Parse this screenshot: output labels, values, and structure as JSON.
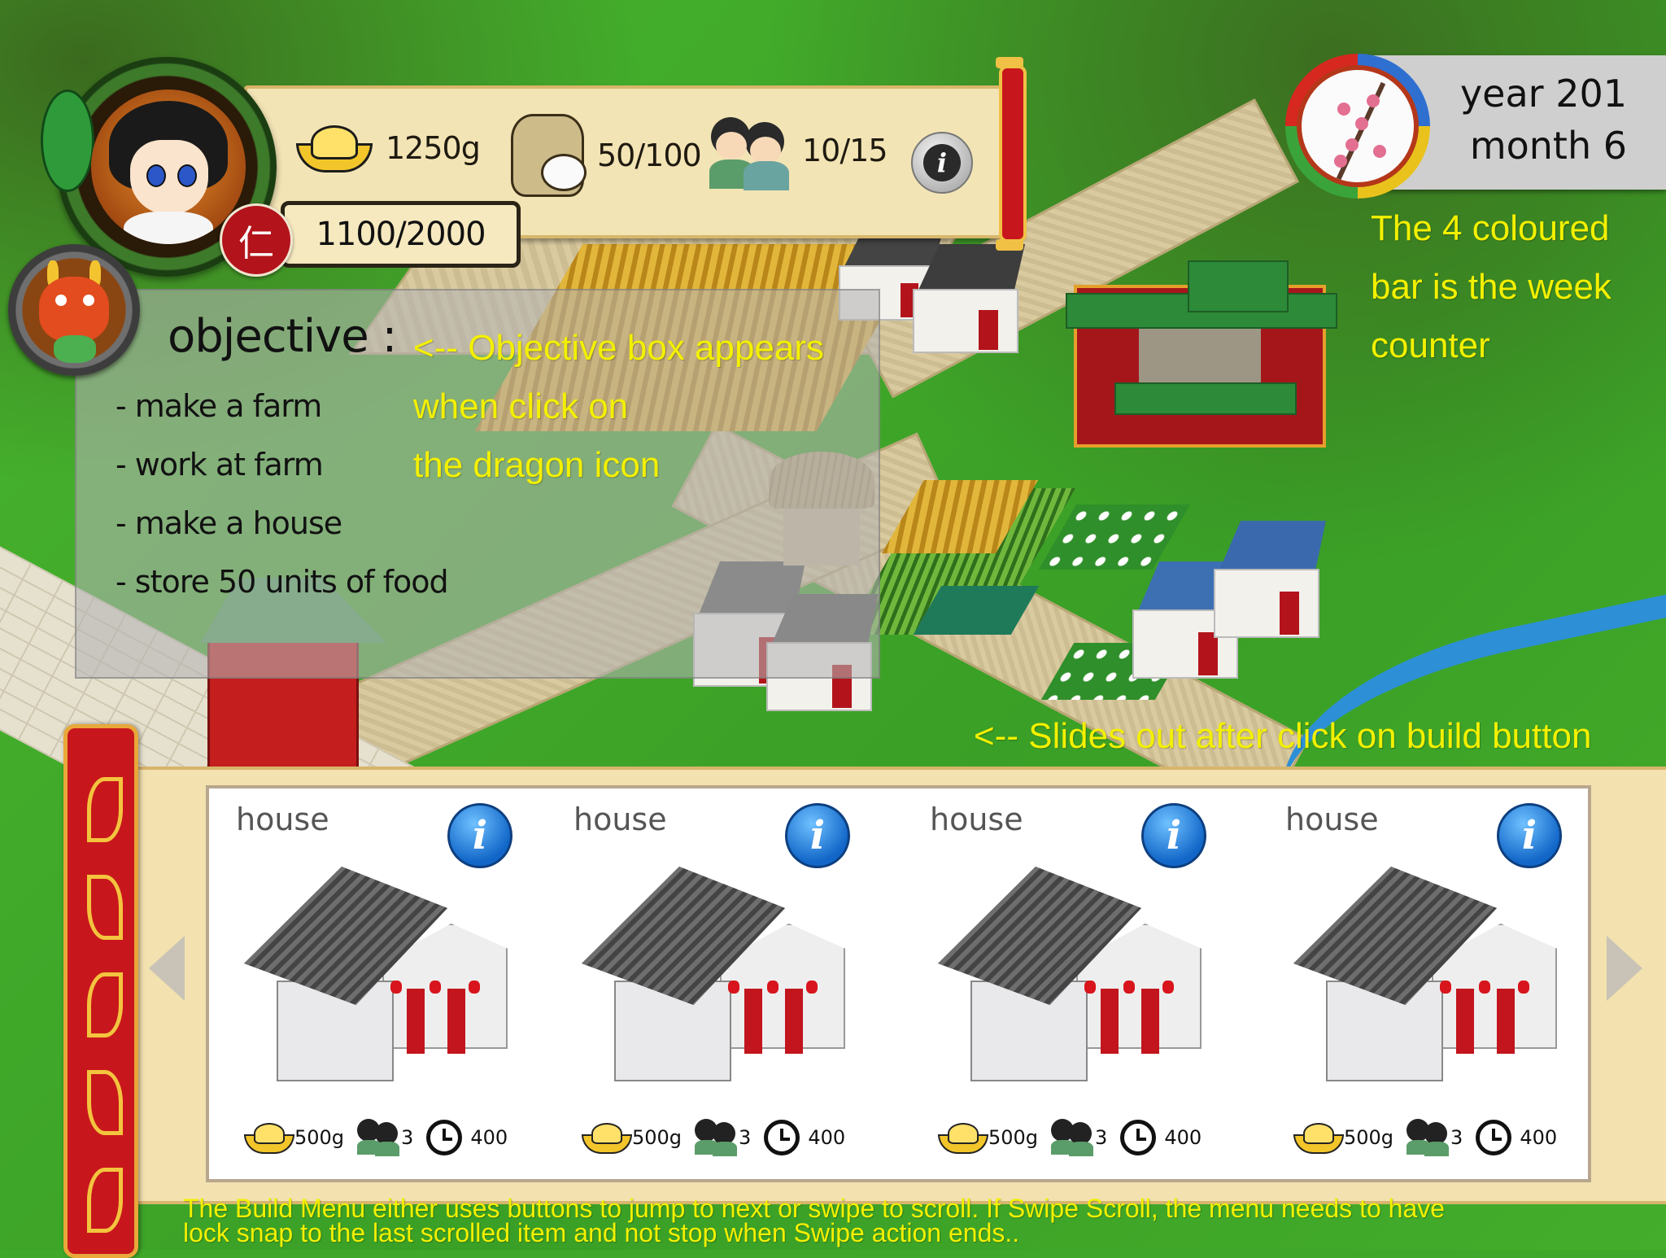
{
  "hud": {
    "gold": "1250g",
    "food": "50/100",
    "population": "10/15",
    "virtue_symbol": "仁",
    "virtue_points": "1100/2000"
  },
  "calendar": {
    "year": "year 201",
    "month": "month 6",
    "week_colors": [
      "#2f6fd0",
      "#e9c21c",
      "#3aa43a",
      "#d7281f"
    ]
  },
  "objective": {
    "title": "objective :",
    "items": [
      "- make a farm",
      "- work at farm",
      "- make a house",
      "- store 50 units of food"
    ]
  },
  "notes": {
    "objective_note": [
      "<-- Objective box appears",
      "when click on",
      "the dragon icon"
    ],
    "week_note": [
      "The 4 coloured",
      "bar is the week",
      "counter"
    ],
    "build_note": "<-- Slides out after click on build button",
    "menu_note": [
      "The Build Menu either uses buttons to jump to next or swipe to scroll. If Swipe Scroll, the menu needs to have",
      "lock snap to the last scrolled item and not stop when Swipe action ends.."
    ]
  },
  "build_menu": {
    "items": [
      {
        "name": "house",
        "gold": "500g",
        "workers": "3",
        "time": "400"
      },
      {
        "name": "house",
        "gold": "500g",
        "workers": "3",
        "time": "400"
      },
      {
        "name": "house",
        "gold": "500g",
        "workers": "3",
        "time": "400"
      },
      {
        "name": "house",
        "gold": "500g",
        "workers": "3",
        "time": "400"
      }
    ]
  },
  "icons": {
    "gold": "gold-ingot-icon",
    "food": "rice-sack-icon",
    "population": "villagers-icon",
    "info": "info-icon",
    "time": "clock-icon",
    "prev": "arrow-left-icon",
    "next": "arrow-right-icon"
  }
}
